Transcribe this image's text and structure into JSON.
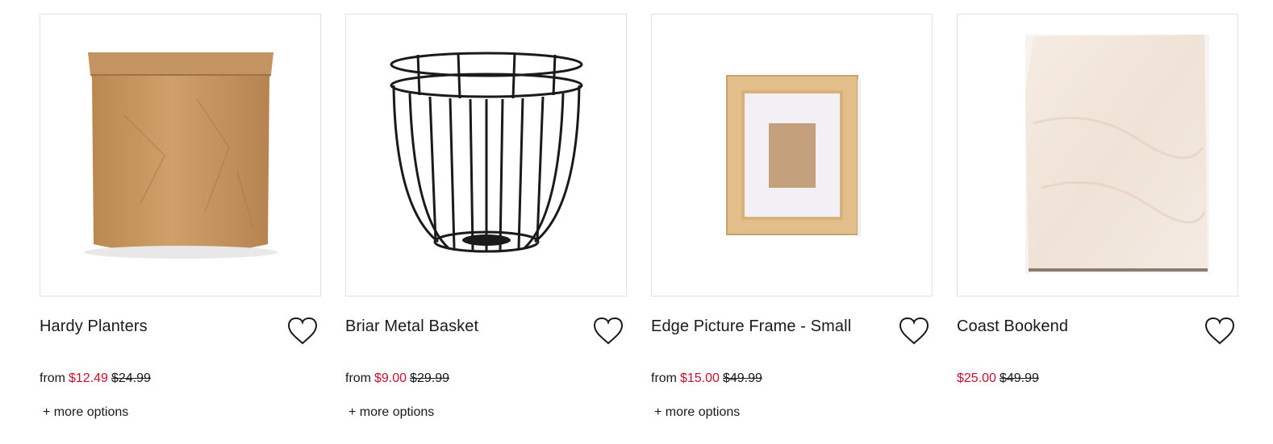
{
  "products": [
    {
      "name": "Hardy Planters",
      "from_label": "from",
      "sale_price": "$12.49",
      "original_price": "$24.99",
      "more_options": "+ more options",
      "image": "kraft-paper-bag-planter"
    },
    {
      "name": "Briar Metal Basket",
      "from_label": "from",
      "sale_price": "$9.00",
      "original_price": "$29.99",
      "more_options": "+ more options",
      "image": "black-wire-basket"
    },
    {
      "name": "Edge Picture Frame - Small",
      "from_label": "from",
      "sale_price": "$15.00",
      "original_price": "$49.99",
      "more_options": "+ more options",
      "image": "wood-picture-frame"
    },
    {
      "name": "Coast Bookend",
      "from_label": "",
      "sale_price": "$25.00",
      "original_price": "$49.99",
      "more_options": "",
      "image": "marble-bookend"
    }
  ],
  "icons": {
    "wishlist": "heart-outline-icon"
  },
  "colors": {
    "sale": "#c8102e",
    "text": "#1a1a1a",
    "border": "#e2e2e2"
  }
}
